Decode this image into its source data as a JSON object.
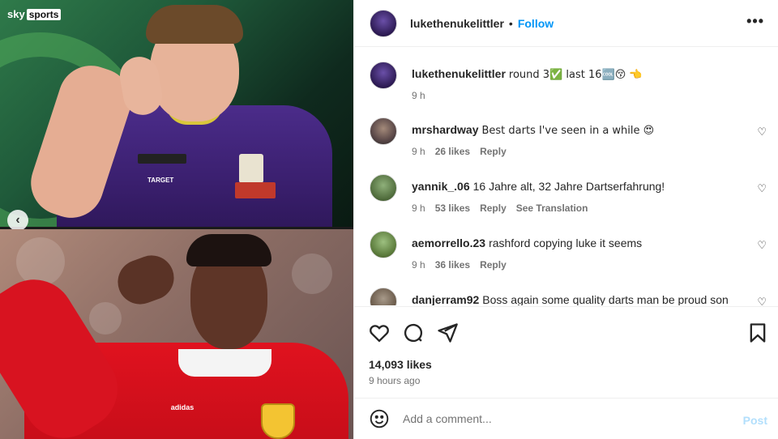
{
  "media": {
    "brand_sky": "sky",
    "brand_sports": "sports",
    "top_patch_text": "TARGET",
    "bottom_logo_text": "adidas",
    "prev_label": "‹"
  },
  "header": {
    "username": "lukethenukelittler",
    "separator": "•",
    "follow_label": "Follow",
    "more_label": "•••"
  },
  "caption": {
    "username": "lukethenukelittler",
    "text": "round 3✅ last 16🆒😚 👈",
    "time": "9 h"
  },
  "comments": [
    {
      "username": "mrshardway",
      "text": "Best darts I've seen in a while 😍",
      "time": "9 h",
      "likes": "26 likes",
      "reply": "Reply",
      "extra": ""
    },
    {
      "username": "yannik_.06",
      "text": "16 Jahre alt, 32 Jahre Dartserfahrung!",
      "time": "9 h",
      "likes": "53 likes",
      "reply": "Reply",
      "extra": "See Translation"
    },
    {
      "username": "aemorrello.23",
      "text": "rashford copying luke it seems",
      "time": "9 h",
      "likes": "36 likes",
      "reply": "Reply",
      "extra": ""
    },
    {
      "username": "danjerram92",
      "text": "Boss again some quality darts man be proud son",
      "time": "",
      "likes": "",
      "reply": "",
      "extra": ""
    }
  ],
  "actions": {
    "likes": "14,093 likes",
    "time": "9 hours ago"
  },
  "add_comment": {
    "placeholder": "Add a comment...",
    "post_label": "Post"
  },
  "colors": {
    "accent": "#0095f6",
    "post_disabled": "#b2dffc",
    "muted": "#737373"
  },
  "icons": [
    "heart-icon",
    "comment-icon",
    "share-icon",
    "bookmark-icon",
    "smile-icon",
    "more-icon",
    "chevron-left-icon"
  ]
}
